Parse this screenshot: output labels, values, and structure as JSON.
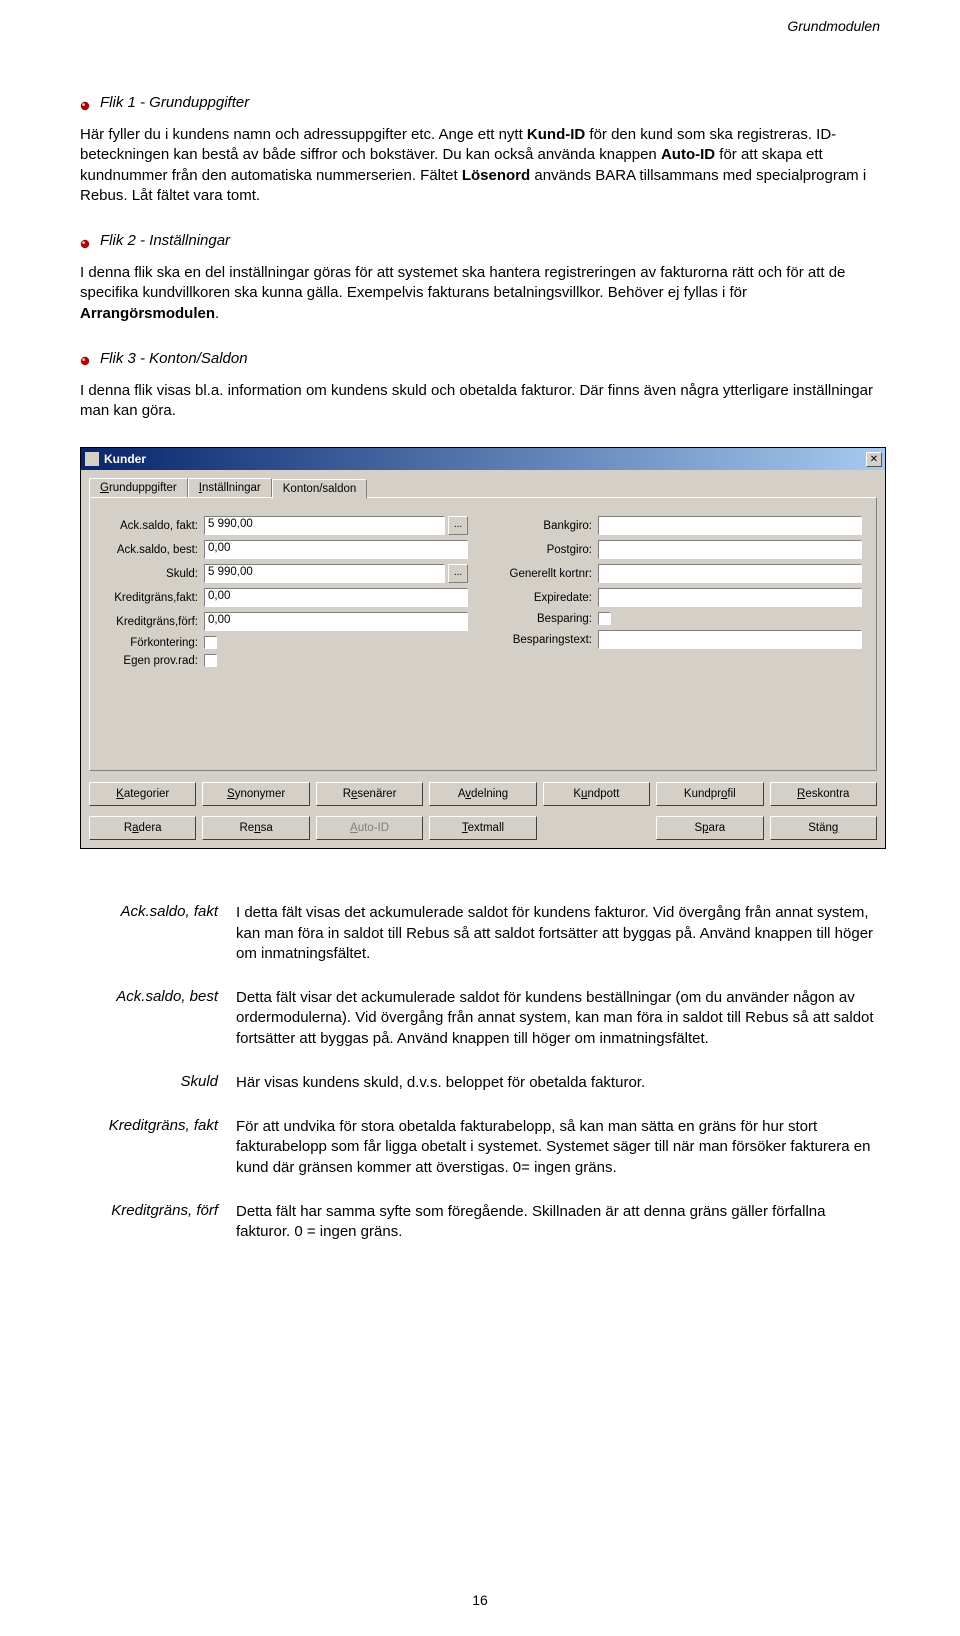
{
  "header": {
    "module": "Grundmodulen"
  },
  "sections": {
    "flik1": {
      "title": "Flik 1 - Grunduppgifter",
      "p_1a": "Här fyller du i kundens namn och adressuppgifter etc. Ange ett nytt ",
      "p_1b": "Kund-ID",
      "p_1c": " för den kund som ska registreras. ID-beteckningen kan bestå av både siffror och bokstäver. Du kan också använda knappen ",
      "p_1d": "Auto-ID",
      "p_1e": " för att skapa ett kundnummer från den automatiska nummerserien. Fältet ",
      "p_1f": "Lösenord",
      "p_1g": " används BARA tillsammans med specialprogram i Rebus. Låt fältet vara tomt."
    },
    "flik2": {
      "title": "Flik 2 - Inställningar",
      "p_a": "I denna flik ska en del inställningar göras för att systemet ska hantera registreringen av fakturorna rätt och för att de specifika kundvillkoren ska kunna gälla. Exempelvis fakturans betalningsvillkor. Behöver ej fyllas i för ",
      "p_b": "Arrangörsmodulen",
      "p_c": "."
    },
    "flik3": {
      "title": "Flik 3 - Konton/Saldon",
      "p": "I denna flik visas bl.a. information om kundens skuld och obetalda fakturor. Där finns även några ytterligare inställningar man kan göra."
    }
  },
  "window": {
    "title": "Kunder",
    "tabs": {
      "t1": "Grunduppgifter",
      "t2": "Inställningar",
      "t3": "Konton/saldon"
    },
    "labels": {
      "ack_fakt": "Ack.saldo, fakt:",
      "ack_best": "Ack.saldo, best:",
      "skuld": "Skuld:",
      "kred_fakt": "Kreditgräns,fakt:",
      "kred_forf": "Kreditgräns,förf:",
      "forkont": "Förkontering:",
      "egen_prov": "Egen prov.rad:",
      "bankgiro": "Bankgiro:",
      "postgiro": "Postgiro:",
      "gen_kort": "Generellt kortnr:",
      "expiredate": "Expiredate:",
      "besparing": "Besparing:",
      "besp_text": "Besparingstext:"
    },
    "values": {
      "ack_fakt": "5 990,00",
      "ack_best": "0,00",
      "skuld": "5 990,00",
      "kred_fakt": "0,00",
      "kred_forf": "0,00",
      "bankgiro": "",
      "postgiro": "",
      "gen_kort": "",
      "expiredate": "",
      "besp_text": ""
    },
    "buttons": {
      "kategorier": "Kategorier",
      "synonymer": "Synonymer",
      "resenarer": "Resenärer",
      "avdelning": "Avdelning",
      "kundpott": "Kundpott",
      "kundprofil": "Kundprofil",
      "reskontra": "Reskontra",
      "radera": "Radera",
      "rensa": "Rensa",
      "autoid": "Auto-ID",
      "textmall": "Textmall",
      "spara": "Spara",
      "stang": "Stäng"
    }
  },
  "defs": {
    "ack_fakt": {
      "label": "Ack.saldo, fakt",
      "text": "I detta fält visas det ackumulerade saldot för kundens fakturor. Vid övergång från annat system, kan man föra in saldot till Rebus så att saldot fortsätter att byggas på. Använd knappen till höger om inmatningsfältet."
    },
    "ack_best": {
      "label": "Ack.saldo, best",
      "text": "Detta fält visar det ackumulerade saldot för kundens beställningar (om du använder någon av ordermodulerna). Vid övergång från annat system, kan man föra in saldot till Rebus så att saldot fortsätter att byggas på. Använd knappen till höger om inmatningsfältet."
    },
    "skuld": {
      "label": "Skuld",
      "text": "Här visas kundens skuld, d.v.s. beloppet för obetalda fakturor."
    },
    "kred_fakt": {
      "label": "Kreditgräns, fakt",
      "text": "För att undvika för stora obetalda fakturabelopp, så kan man sätta en gräns för hur stort fakturabelopp som får ligga obetalt i systemet. Systemet säger till när man försöker fakturera en kund där gränsen kommer att överstigas. 0= ingen gräns."
    },
    "kred_forf": {
      "label": "Kreditgräns, förf",
      "text": "Detta fält har samma syfte som föregående. Skillnaden är att denna gräns gäller förfallna fakturor. 0 = ingen gräns."
    }
  },
  "page_number": "16"
}
